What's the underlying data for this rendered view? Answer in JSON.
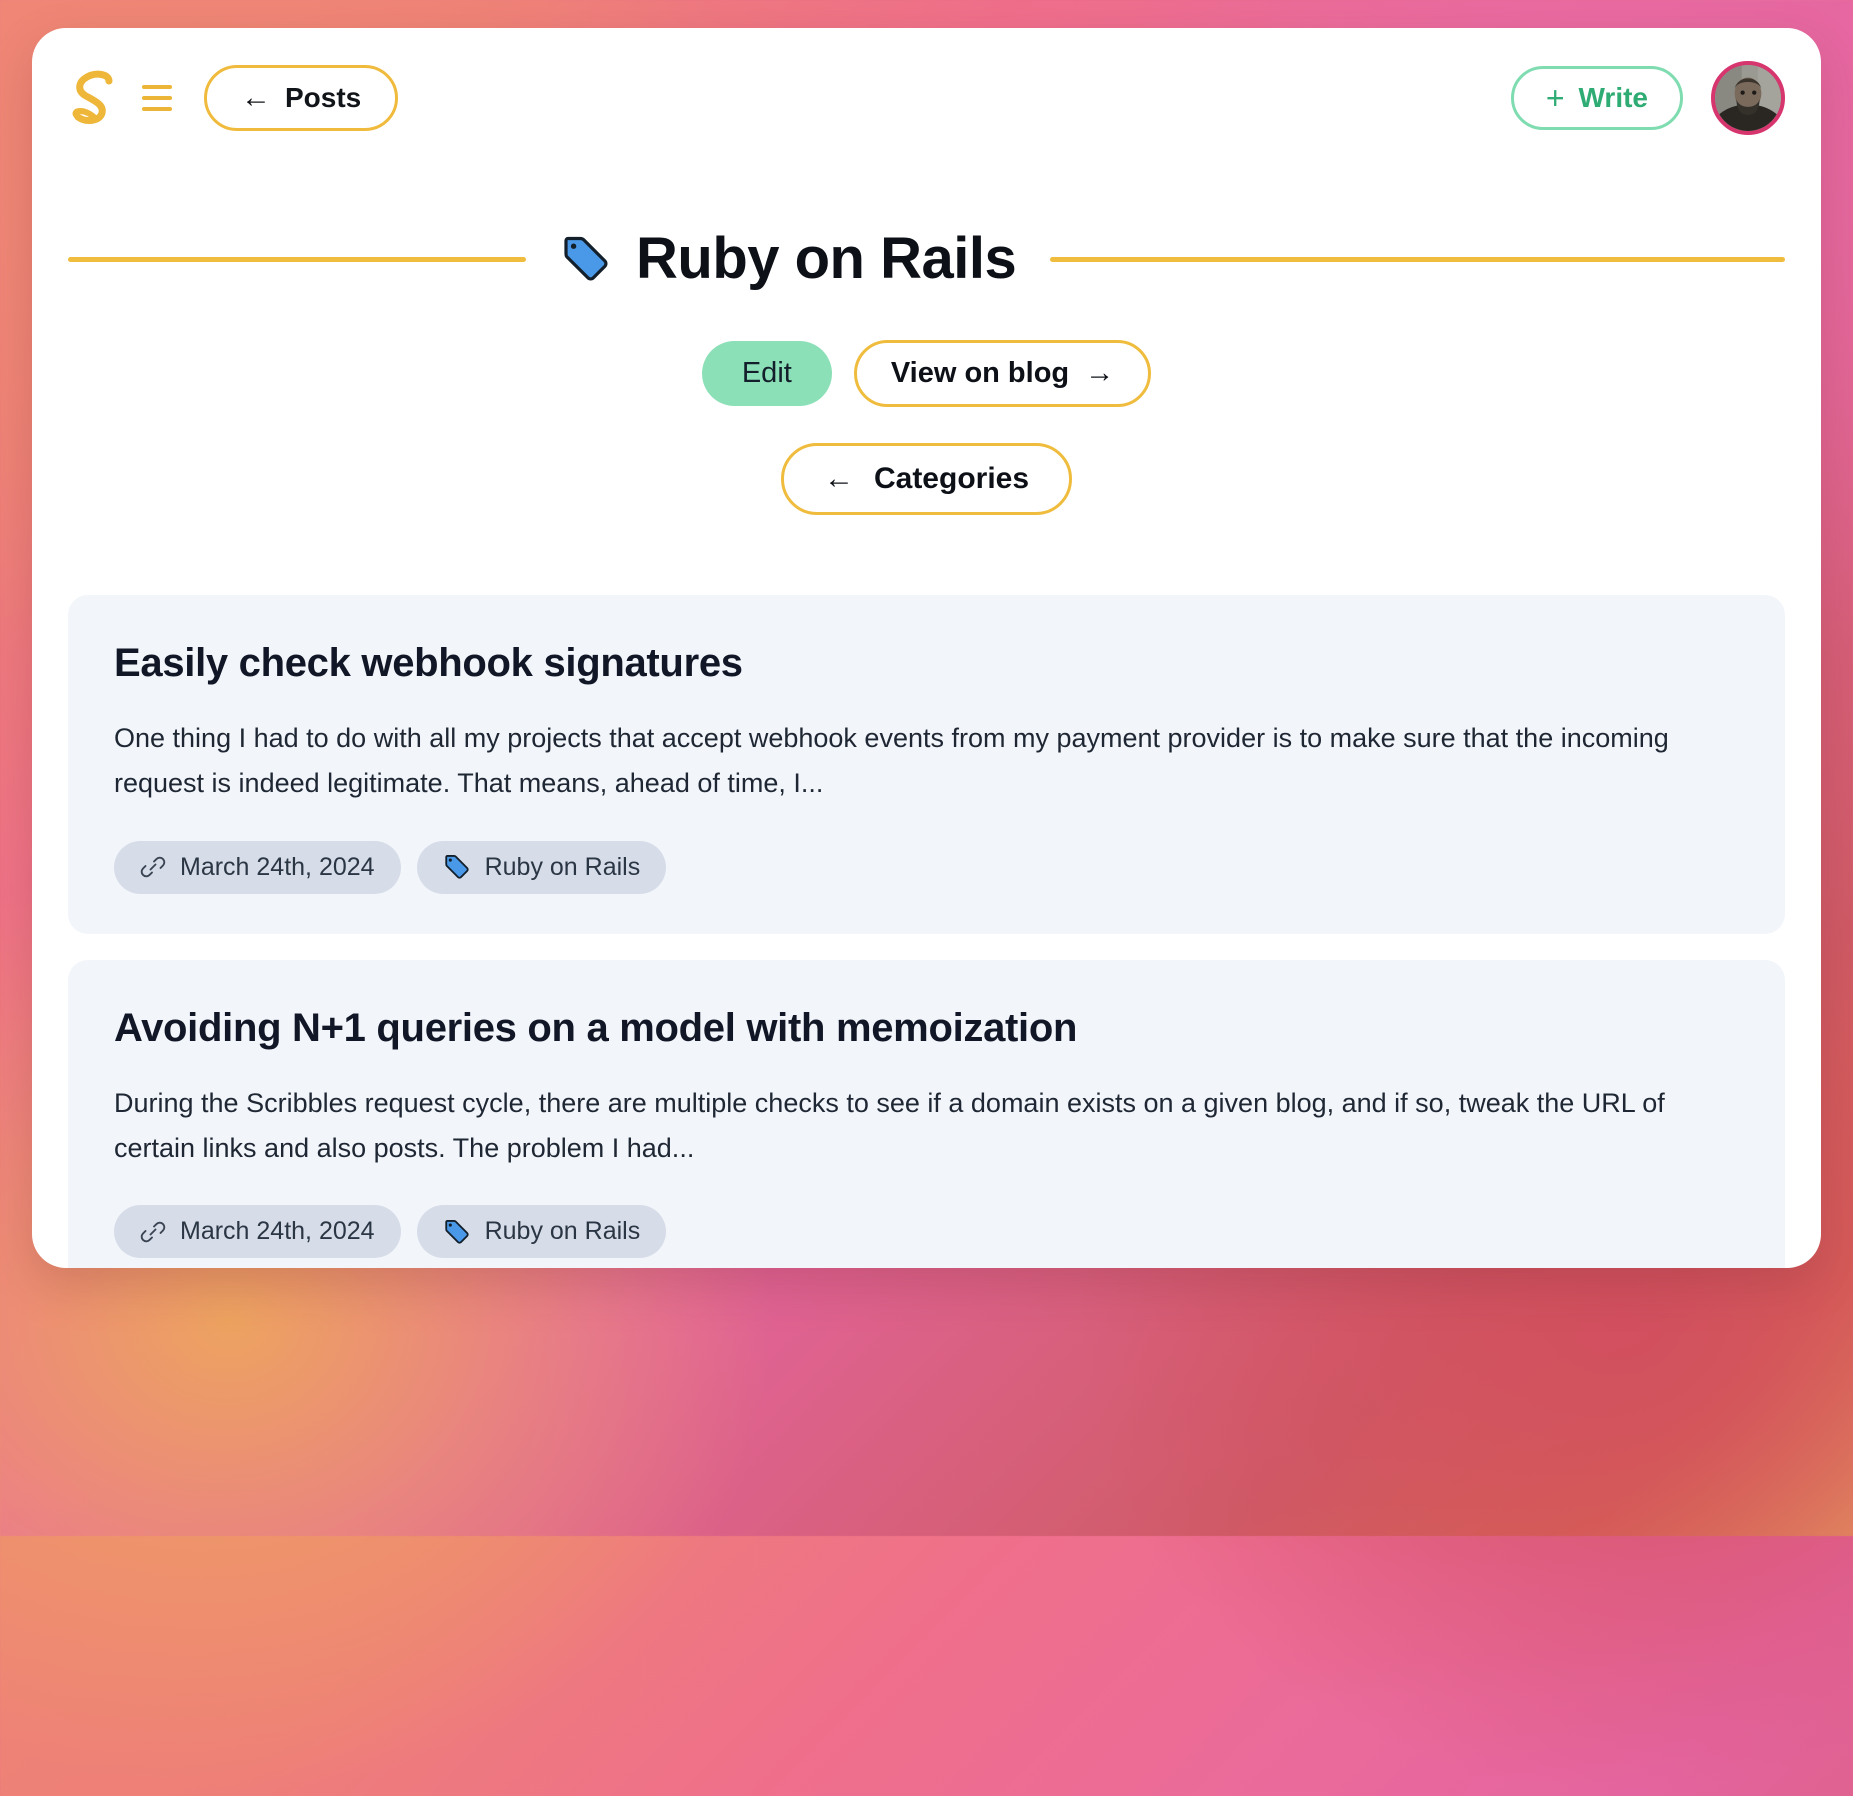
{
  "window": {
    "background_colors": {
      "top_left": "#ef8476",
      "top_right": "#e86ba4",
      "bottom_left": "#eda360",
      "bottom_right": "#d24f5f"
    },
    "surface": "#ffffff"
  },
  "header": {
    "logo_name": "scribbles-logo",
    "menu_icon": "hamburger-menu-icon",
    "back_button": {
      "icon": "arrow-left-icon",
      "arrow": "←",
      "label": "Posts"
    },
    "write_button": {
      "icon": "plus-icon",
      "plus": "+",
      "label": "Write"
    },
    "avatar_name": "user-avatar",
    "accent_yellow": "#efbc3d",
    "accent_green": "#7fdcb0",
    "avatar_ring": "#d6356d"
  },
  "page": {
    "tag_icon": "tag-icon",
    "title": "Ruby on Rails",
    "rule_color": "#efbc3d",
    "actions": {
      "edit_label": "Edit",
      "edit_bg": "#8ce0b8",
      "view_label": "View on blog",
      "view_arrow": "→",
      "categories_arrow": "←",
      "categories_label": "Categories"
    }
  },
  "posts": [
    {
      "title": "Easily check webhook signatures",
      "excerpt": "One thing I had to do with all my projects that accept webhook events from my payment provider is to make sure that the incoming request is indeed legitimate. That means, ahead of time, I...",
      "date_icon": "link-icon",
      "date": "March 24th, 2024",
      "category_icon": "tag-icon",
      "category": "Ruby on Rails"
    },
    {
      "title": "Avoiding N+1 queries on a model with memoization",
      "excerpt": "During the Scribbles request cycle, there are multiple checks to see if a domain exists on a given blog, and if so, tweak the URL of certain links and also posts. The problem I had...",
      "date_icon": "link-icon",
      "date": "March 24th, 2024",
      "category_icon": "tag-icon",
      "category": "Ruby on Rails"
    }
  ]
}
